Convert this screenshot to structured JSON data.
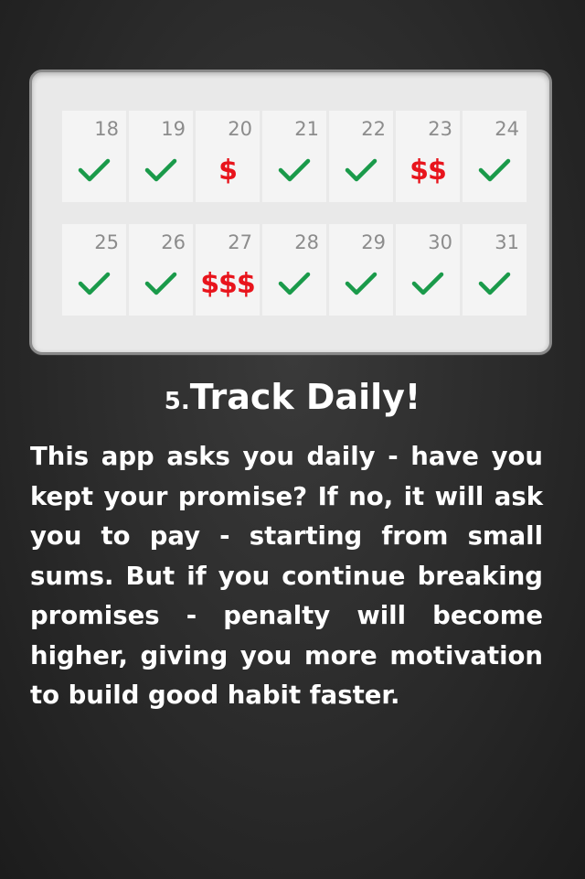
{
  "calendar": {
    "weeks": [
      [
        {
          "day": "18",
          "status": "check"
        },
        {
          "day": "19",
          "status": "check"
        },
        {
          "day": "20",
          "status": "penalty",
          "label": "$"
        },
        {
          "day": "21",
          "status": "check"
        },
        {
          "day": "22",
          "status": "check"
        },
        {
          "day": "23",
          "status": "penalty",
          "label": "$$"
        },
        {
          "day": "24",
          "status": "check"
        }
      ],
      [
        {
          "day": "25",
          "status": "check"
        },
        {
          "day": "26",
          "status": "check"
        },
        {
          "day": "27",
          "status": "penalty",
          "label": "$$$"
        },
        {
          "day": "28",
          "status": "check"
        },
        {
          "day": "29",
          "status": "check"
        },
        {
          "day": "30",
          "status": "check"
        },
        {
          "day": "31",
          "status": "check"
        }
      ]
    ],
    "check_color": "#1a9a4a",
    "penalty_color": "#e8141c"
  },
  "step": {
    "number": "5.",
    "title": "Track Daily!"
  },
  "description": "This app asks you daily - have you kept your promise? If no, it will ask you to pay - starting from small sums. But if you continue breaking promises - penalty will become higher, giving you more motivation to build good habit faster."
}
